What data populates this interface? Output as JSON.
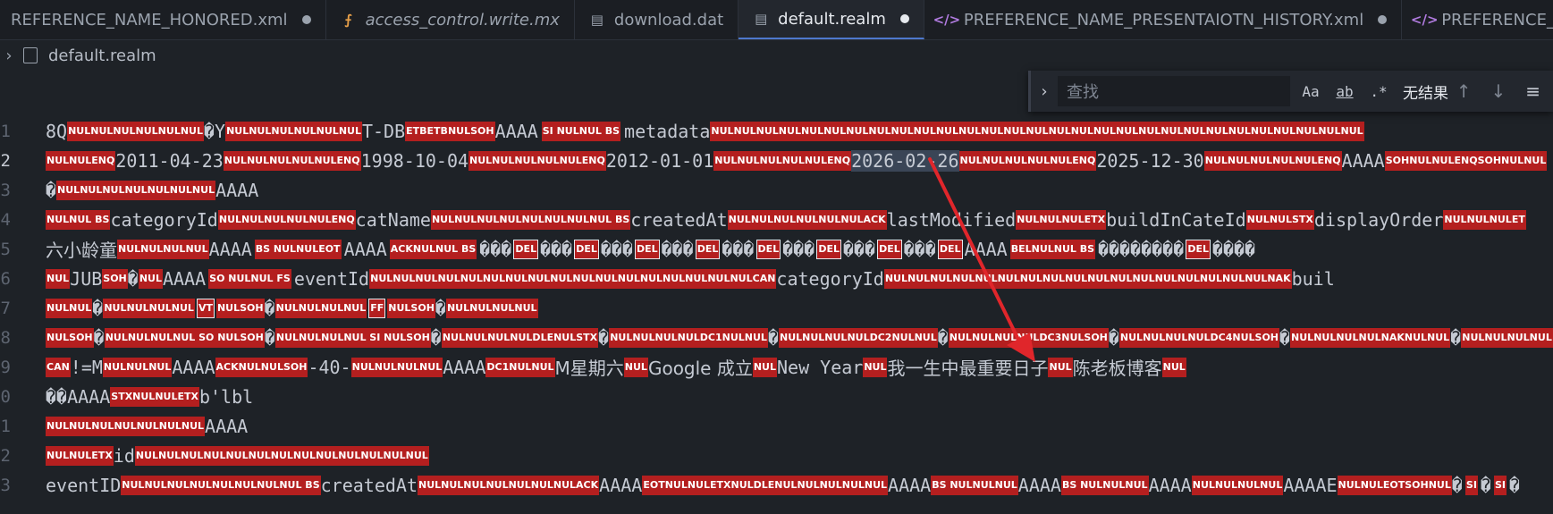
{
  "tabs": [
    {
      "label": "REFERENCE_NAME_HONORED.xml",
      "icon": "xml-icon",
      "modified": true
    },
    {
      "label": "access_control.write.mx",
      "icon": "mx-icon",
      "modified": false
    },
    {
      "label": "download.dat",
      "icon": "file-icon",
      "modified": false
    },
    {
      "label": "default.realm",
      "icon": "file-icon",
      "modified": true,
      "active": true
    },
    {
      "label": "PREFERENCE_NAME_PRESENTAIOTN_HISTORY.xml",
      "icon": "xml-icon",
      "modified": true
    },
    {
      "label": "PREFERENCE_",
      "icon": "xml-icon",
      "modified": false
    }
  ],
  "breadcrumb": {
    "file": "default.realm"
  },
  "find": {
    "placeholder": "查找",
    "match_case": "Aa",
    "whole_word": "ab",
    "regex": ".*",
    "result": "无结果"
  },
  "line_numbers": [
    "1",
    "2",
    "3",
    "4",
    "5",
    "6",
    "7",
    "8",
    "9",
    "0",
    "1",
    "2",
    "3"
  ],
  "lines": {
    "l1": [
      "8Q",
      "NULNULNULNULNULNUL",
      "�Y",
      "NULNULNULNULNULNUL",
      "T-DB",
      "ETBETBNULSOH",
      "AAAA",
      "SI NULNUL BS",
      "metadata",
      "NULNULNULNULNULNULNULNULNULNULNULNULNULNULNULNULNULNULNULNULNULNULNULNULNULNULNULNULNUL"
    ],
    "l2": [
      "NULNULENQ",
      "2011-04-23",
      "NULNULNULNULNULENQ",
      "1998-10-04",
      "NULNULNULNULNULENQ",
      "2012-01-01",
      "NULNULNULNULNULENQ",
      "2026-02-26",
      "NULNULNULNULNULENQ",
      "2025-12-30",
      "NULNULNULNULNULENQ",
      "AAAA",
      "SOHNULNULENQSOHNULNUL"
    ],
    "l3": [
      "�",
      "NULNULNULNULNULNULNUL",
      "AAAA"
    ],
    "l4": [
      "NULNUL BS",
      "categoryId",
      "NULNULNULNULNULENQ",
      "catName",
      "NULNULNULNULNULNULNULNUL BS",
      "createdAt",
      "NULNULNULNULNULNULACK",
      "lastModified",
      "NULNULNULETX",
      "buildInCateId",
      "NULNULSTX",
      "displayOrder",
      "NULNULNULET"
    ],
    "l5": [
      "六小龄童",
      "NULNULNULNUL",
      "AAAA",
      "BS NULNULEOT",
      "AAAA",
      "ACKNULNUL BS",
      "���",
      "DEL",
      "���",
      "DEL",
      "���",
      "DEL",
      "���",
      "DEL",
      "���",
      "DEL",
      "���",
      "DEL",
      "���",
      "DEL",
      "���",
      "DEL",
      "AAAA",
      "BELNULNUL BS",
      "��������",
      "DEL",
      "����"
    ],
    "l6": [
      "NUL",
      "JUB",
      "SOH",
      "�",
      "NUL",
      "AAAA",
      "SO NULNUL FS",
      "eventId",
      "NULNULNULNULNULNULNULNULNULNULNULNULNULNULNULNULNULCAN",
      "categoryId",
      "NULNULNULNULNULNULNULNULNULNULNULNULNULNULNULNULNULNAK",
      "buil"
    ],
    "l7": [
      "NULNUL",
      "�",
      "NULNULNULNUL",
      "VT",
      "NULSOH",
      "�",
      "NULNULNULNUL",
      "FF",
      "NULSOH",
      "�",
      "NULNULNULNUL"
    ],
    "l8": [
      "NULSOH",
      "�",
      "NULNULNULNUL SO NULSOH",
      "�",
      "NULNULNULNUL SI NULSOH",
      "�",
      "NULNULNULNULDLENULSTX",
      "�",
      "NULNULNULNULDC1NULNUL",
      "�",
      "NULNULNULNULDC2NULNUL",
      "�",
      "NULNULNULNULDC3NULSOH",
      "�",
      "NULNULNULNULDC4NULSOH",
      "�",
      "NULNULNULNULNAKNULNUL",
      "�",
      "NULNULNULNUL"
    ],
    "l9": [
      "CAN",
      "!=M",
      "NULNULNUL",
      "AAAA",
      "ACKNULNULSOH",
      "-40-",
      "NULNULNULNUL",
      "AAAA",
      "DC1NULNUL",
      "M星期六",
      "NUL",
      "Google 成立",
      "NUL",
      "New Year",
      "NUL",
      "我一生中最重要日子",
      "NUL",
      "陈老板博客",
      "NUL"
    ],
    "l10": [
      "��",
      "AAAA",
      "STXNULNULETX",
      "b'lbl"
    ],
    "l11": [
      "NULNULNULNULNULNULNUL",
      "AAAA"
    ],
    "l12": [
      "NULNULETX",
      "id",
      "NULNULNULNULNULNULNULNULNULNULNULNULNUL"
    ],
    "l13": [
      "eventID",
      "NULNULNULNULNULNULNULNUL BS",
      "createdAt",
      "NULNULNULNULNULNULNULACK",
      "AAAA",
      "EOTNULNULETXNULDLENULNULNULNULNUL",
      "AAAA",
      "BS NULNULNUL",
      "AAAA",
      "BS NULNULNUL",
      "AAAA",
      "NULNULNULNUL",
      "AAAAE",
      "NULNULEOTSOHNUL",
      "�",
      "SI",
      "�",
      "SI",
      "�"
    ]
  },
  "colors": {
    "control_bg": "#b41f1f",
    "selection": "#3a4556",
    "arrow": "#e0262b",
    "accent": "#4d78cc"
  }
}
